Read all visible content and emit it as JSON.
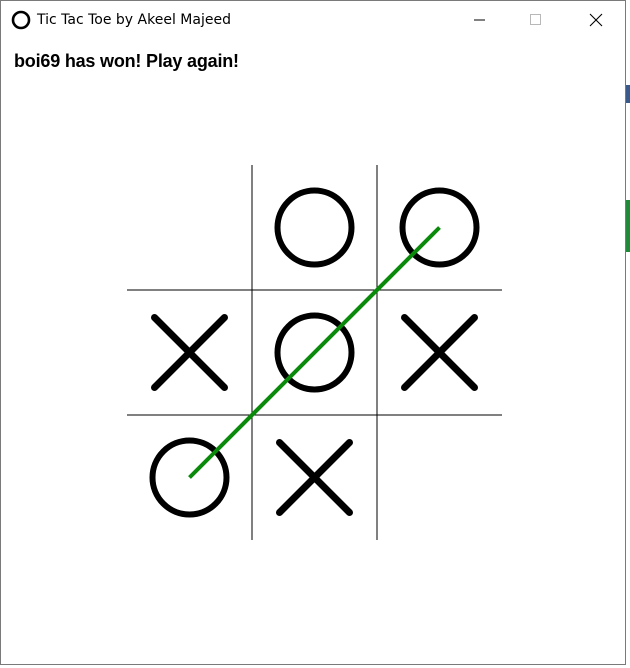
{
  "window": {
    "title": "Tic Tac Toe by Akeel Majeed",
    "app_icon": "circle-icon",
    "controls": [
      "minimize-icon",
      "maximize-icon",
      "close-icon"
    ]
  },
  "status": {
    "message": "boi69 has won! Play again!"
  },
  "board": {
    "cells": [
      [
        "",
        "O",
        "O"
      ],
      [
        "X",
        "O",
        "X"
      ],
      [
        "O",
        "X",
        ""
      ]
    ],
    "winning_line": {
      "from": [
        2,
        0
      ],
      "to": [
        0,
        2
      ]
    },
    "colors": {
      "grid": "#000000",
      "marks": "#000000",
      "win_line": "#0a8a0a"
    }
  }
}
